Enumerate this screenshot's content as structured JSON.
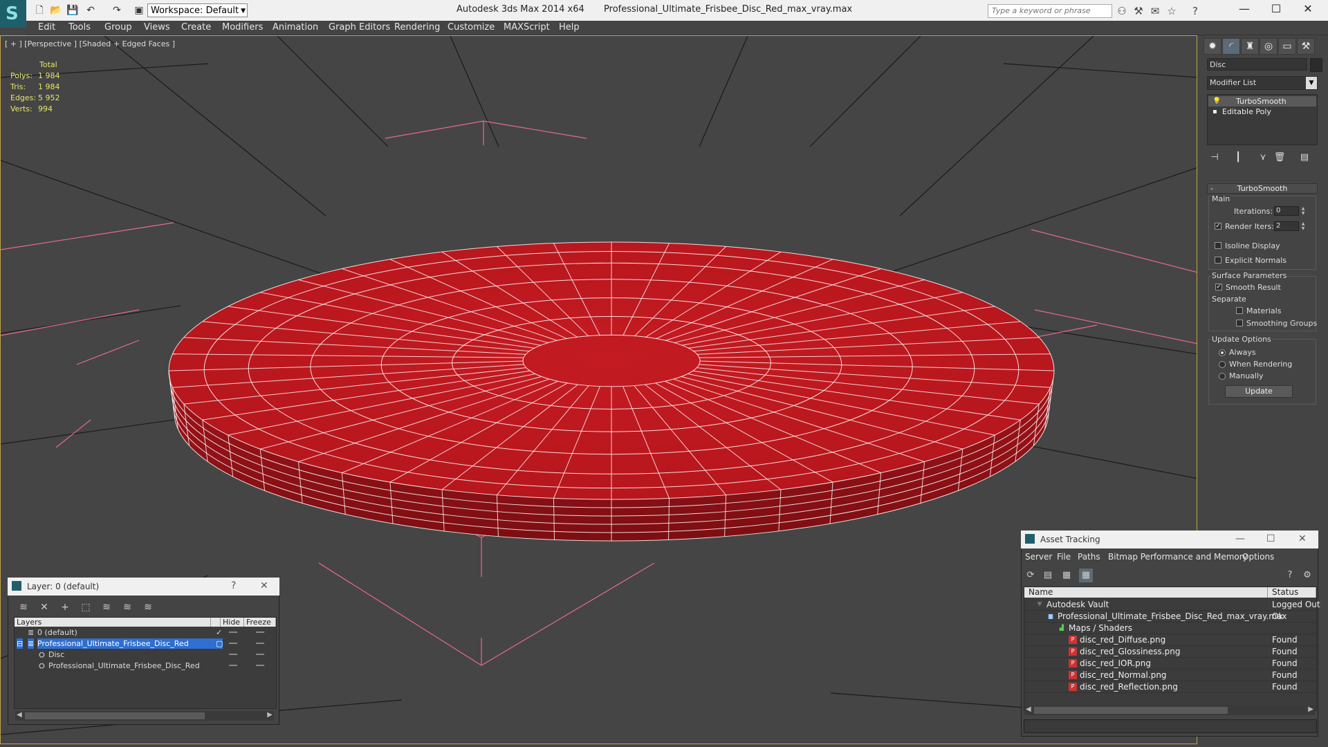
{
  "window": {
    "app": "Autodesk 3ds Max  2014 x64",
    "file": "Professional_Ultimate_Frisbee_Disc_Red_max_vray.max",
    "workspace_label": "Workspace: Default",
    "search_placeholder": "Type a keyword or phrase"
  },
  "menubar": [
    "Edit",
    "Tools",
    "Group",
    "Views",
    "Create",
    "Modifiers",
    "Animation",
    "Graph Editors",
    "Rendering",
    "Customize",
    "MAXScript",
    "Help"
  ],
  "viewport": {
    "label": "[ + ] [Perspective ] [Shaded + Edged Faces ]",
    "stats_header": "Total",
    "stats": [
      {
        "label": "Polys:",
        "value": "1 984"
      },
      {
        "label": "Tris:",
        "value": "1 984"
      },
      {
        "label": "Edges:",
        "value": "5 952"
      },
      {
        "label": "Verts:",
        "value": "994"
      }
    ],
    "disc_color": "#b5161c",
    "wire_color": "#ffffff",
    "grid_color": "#1a1a1a",
    "gizmo_color": "#e86a8a"
  },
  "command_panel": {
    "object_name": "Disc",
    "modifier_list": "Modifier List",
    "stack": [
      "TurboSmooth",
      "Editable Poly"
    ],
    "rollout_title": "TurboSmooth",
    "main_label": "Main",
    "iterations_label": "Iterations:",
    "iterations_value": "0",
    "render_iters_label": "Render Iters:",
    "render_iters_value": "2",
    "render_iters_checked": true,
    "isoline_label": "Isoline Display",
    "explicit_normals_label": "Explicit Normals",
    "surface_params_label": "Surface Parameters",
    "smooth_result_label": "Smooth Result",
    "separate_label": "Separate",
    "materials_label": "Materials",
    "smoothing_groups_label": "Smoothing Groups",
    "update_options_label": "Update Options",
    "always_label": "Always",
    "when_rendering_label": "When Rendering",
    "manually_label": "Manually",
    "update_button": "Update"
  },
  "layer_dialog": {
    "title": "Layer: 0 (default)",
    "help": "?",
    "close": "✕",
    "columns": [
      "Layers",
      "Hide",
      "Freeze"
    ],
    "rows": [
      {
        "name": "0 (default)",
        "indent": 1,
        "selected": false
      },
      {
        "name": "Professional_Ultimate_Frisbee_Disc_Red",
        "indent": 1,
        "selected": true
      },
      {
        "name": "Disc",
        "indent": 2,
        "selected": false
      },
      {
        "name": "Professional_Ultimate_Frisbee_Disc_Red",
        "indent": 2,
        "selected": false
      }
    ]
  },
  "asset_dialog": {
    "title": "Asset Tracking",
    "menu": [
      "Server",
      "File",
      "Paths",
      "Bitmap Performance and Memory",
      "Options"
    ],
    "columns": [
      "Name",
      "Status"
    ],
    "rows": [
      {
        "name": "Autodesk Vault",
        "status": "Logged Out",
        "indent": 1
      },
      {
        "name": "Professional_Ultimate_Frisbee_Disc_Red_max_vray.max",
        "status": "Ok",
        "indent": 2
      },
      {
        "name": "Maps / Shaders",
        "status": "",
        "indent": 3
      },
      {
        "name": "disc_red_Diffuse.png",
        "status": "Found",
        "indent": 4
      },
      {
        "name": "disc_red_Glossiness.png",
        "status": "Found",
        "indent": 4
      },
      {
        "name": "disc_red_IOR.png",
        "status": "Found",
        "indent": 4
      },
      {
        "name": "disc_red_Normal.png",
        "status": "Found",
        "indent": 4
      },
      {
        "name": "disc_red_Reflection.png",
        "status": "Found",
        "indent": 4
      }
    ]
  }
}
